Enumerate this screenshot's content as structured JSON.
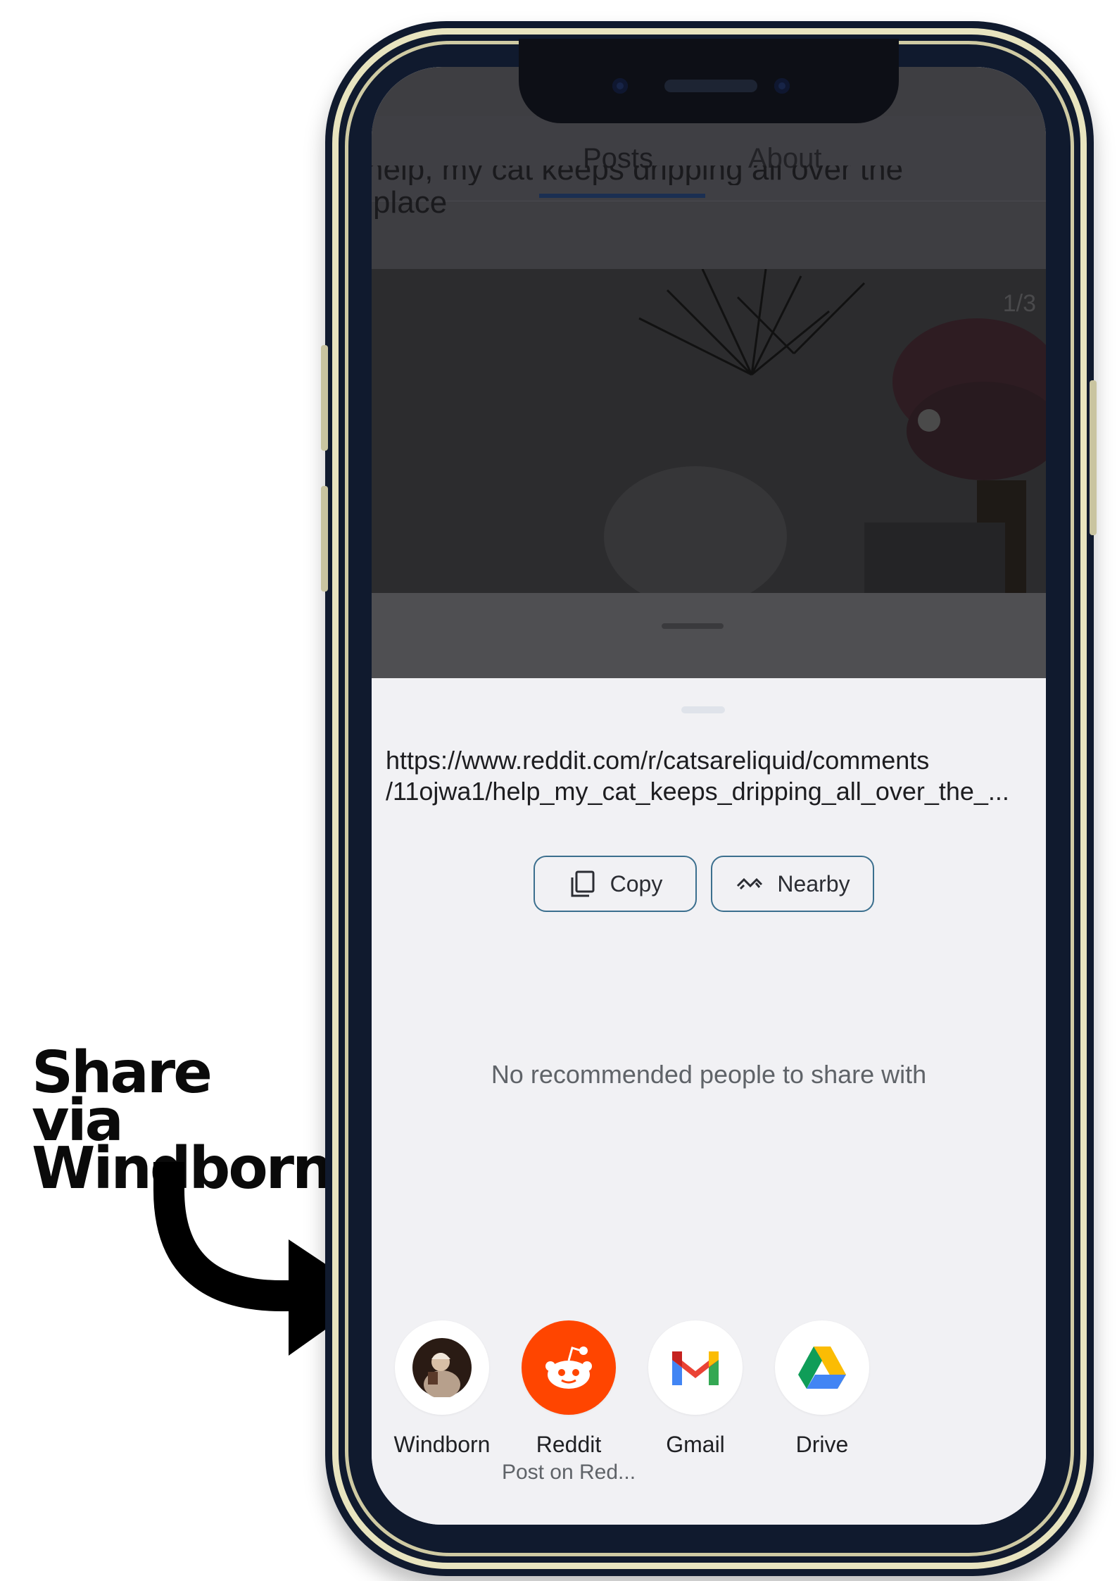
{
  "annotation": {
    "line1": "Share via",
    "line2": "Windborn"
  },
  "background_app": {
    "tabs": [
      {
        "label": "Posts"
      },
      {
        "label": "About"
      }
    ],
    "post_title_partial": "help, my cat keeps dripping all over the",
    "post_title_line2": "place",
    "image_counter": "1/3"
  },
  "share_sheet": {
    "url_line1": "https://www.reddit.com/r/catsareliquid/comments",
    "url_line2": "/11ojwa1/help_my_cat_keeps_dripping_all_over_the_...",
    "copy_label": "Copy",
    "nearby_label": "Nearby",
    "no_people_text": "No recommended people to share with",
    "apps": [
      {
        "label": "Windborn",
        "sublabel": "",
        "icon": "windborn-avatar-icon"
      },
      {
        "label": "Reddit",
        "sublabel": "Post on Red...",
        "icon": "reddit-icon"
      },
      {
        "label": "Gmail",
        "sublabel": "",
        "icon": "gmail-icon"
      },
      {
        "label": "Drive",
        "sublabel": "",
        "icon": "drive-icon"
      }
    ]
  },
  "colors": {
    "sheet_bg": "#f1f1f4",
    "pill_border": "#3b6f8e",
    "reddit_orange": "#ff4500",
    "phone_frame": "#101a2e",
    "phone_trim": "#e8e4bf"
  }
}
